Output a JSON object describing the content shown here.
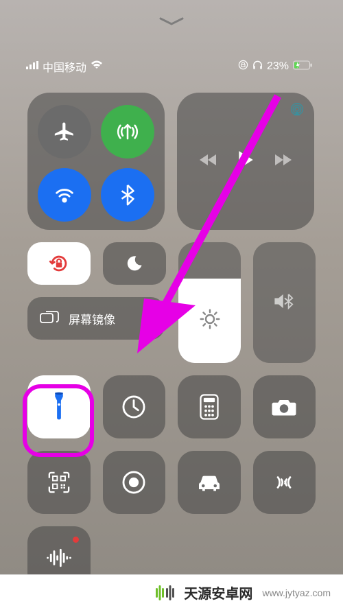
{
  "statusbar": {
    "carrier": "中国移动",
    "battery_pct": "23%"
  },
  "tiles": {
    "screen_mirroring_label": "屏幕镜像"
  },
  "watermark": {
    "title": "天源安卓网",
    "url": "www.jytyaz.com"
  }
}
